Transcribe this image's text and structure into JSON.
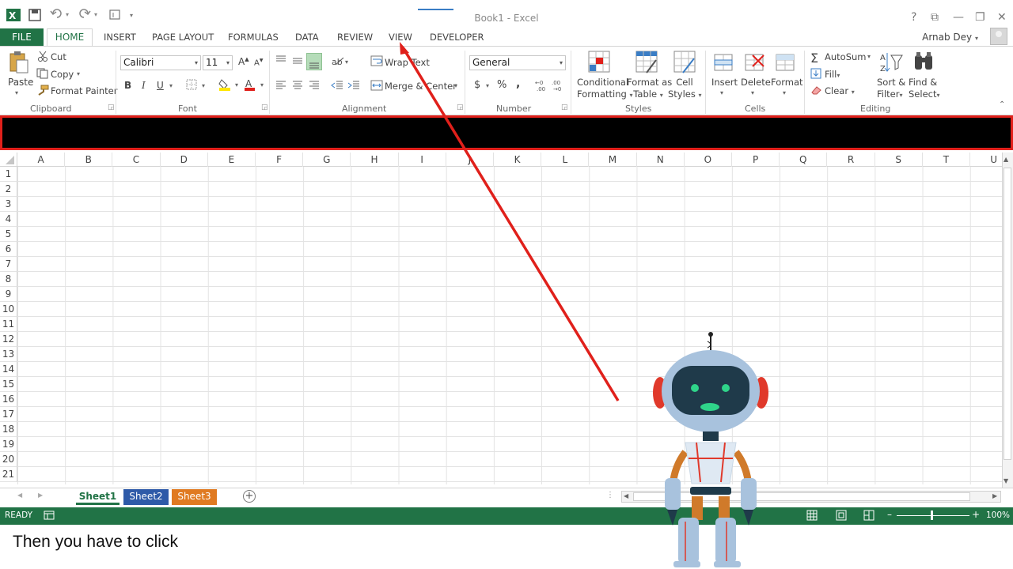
{
  "window": {
    "title": "Book1 - Excel",
    "help": "?",
    "restore_ribbon": "⧉",
    "minimize": "—",
    "maximize": "❐",
    "close": "✕"
  },
  "quick_access": {
    "app_icon": "excel-logo-icon",
    "save_icon": "save-icon",
    "undo_icon": "undo-icon",
    "redo_icon": "redo-icon",
    "touch_icon": "touch-mode-icon"
  },
  "tabs": {
    "file": "FILE",
    "home": "HOME",
    "items": [
      "INSERT",
      "PAGE LAYOUT",
      "FORMULAS",
      "DATA",
      "REVIEW",
      "VIEW",
      "DEVELOPER"
    ]
  },
  "user": {
    "name": "Arnab Dey"
  },
  "ribbon": {
    "clipboard": {
      "label": "Clipboard",
      "paste": "Paste",
      "cut": "Cut",
      "copy": "Copy",
      "format_painter": "Format Painter"
    },
    "font": {
      "label": "Font",
      "name": "Calibri",
      "size": "11",
      "bold": "B",
      "italic": "I",
      "underline": "U"
    },
    "alignment": {
      "label": "Alignment",
      "wrap_text": "Wrap Text",
      "merge_center": "Merge & Center"
    },
    "number": {
      "label": "Number",
      "format": "General",
      "currency": "$",
      "percent": "%",
      "comma": ",",
      "inc_decimal": "←0 .00",
      "dec_decimal": ".00 →0"
    },
    "styles": {
      "label": "Styles",
      "conditional": [
        "Conditional",
        "Formatting"
      ],
      "format_table": [
        "Format as",
        "Table"
      ],
      "cell_styles": [
        "Cell",
        "Styles"
      ]
    },
    "cells": {
      "label": "Cells",
      "insert": "Insert",
      "delete": "Delete",
      "format": "Format"
    },
    "editing": {
      "label": "Editing",
      "autosum": "AutoSum",
      "fill": "Fill",
      "clear": "Clear",
      "sort_filter": [
        "Sort &",
        "Filter"
      ],
      "find_select": [
        "Find &",
        "Select"
      ]
    }
  },
  "grid": {
    "columns": [
      "A",
      "B",
      "C",
      "D",
      "E",
      "F",
      "G",
      "H",
      "I",
      "J",
      "K",
      "L",
      "M",
      "N",
      "O",
      "P",
      "Q",
      "R",
      "S",
      "T",
      "U"
    ],
    "rows": [
      "1",
      "2",
      "3",
      "4",
      "5",
      "6",
      "7",
      "8",
      "9",
      "10",
      "11",
      "12",
      "13",
      "14",
      "15",
      "16",
      "17",
      "18",
      "19",
      "20",
      "21"
    ]
  },
  "sheets": [
    "Sheet1",
    "Sheet2",
    "Sheet3"
  ],
  "status": {
    "ready": "READY",
    "zoom": "100%"
  },
  "caption": "Then you have to click",
  "colors": {
    "excel_green": "#217346",
    "annotation_red": "#e0201b",
    "sheet2": "#2e5aa8",
    "sheet3": "#e07a21"
  }
}
